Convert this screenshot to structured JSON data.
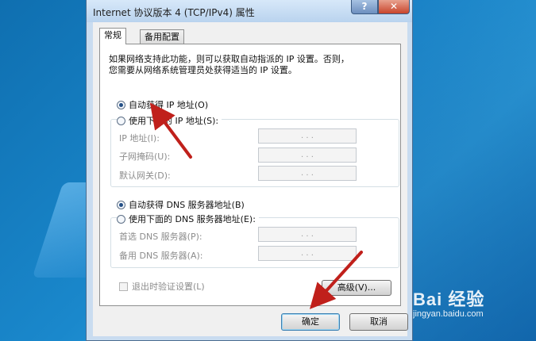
{
  "window": {
    "title": "Internet 协议版本 4 (TCP/IPv4) 属性",
    "help_glyph": "?",
    "close_glyph": "✕"
  },
  "tabs": [
    {
      "label": "常规",
      "active": true
    },
    {
      "label": "备用配置",
      "active": false
    }
  ],
  "description": {
    "line1": "如果网络支持此功能，则可以获取自动指派的 IP 设置。否则，",
    "line2": "您需要从网络系统管理员处获得适当的 IP 设置。"
  },
  "ip_section": {
    "auto_label": "自动获得 IP 地址(O)",
    "auto_checked": true,
    "manual_label": "使用下面的 IP 地址(S):",
    "manual_checked": false,
    "fields": [
      {
        "label": "IP 地址(I):",
        "value": ".   .   ."
      },
      {
        "label": "子网掩码(U):",
        "value": ".   .   ."
      },
      {
        "label": "默认网关(D):",
        "value": ".   .   ."
      }
    ]
  },
  "dns_section": {
    "auto_label": "自动获得 DNS 服务器地址(B)",
    "auto_checked": true,
    "manual_label": "使用下面的 DNS 服务器地址(E):",
    "manual_checked": false,
    "fields": [
      {
        "label": "首选 DNS 服务器(P):",
        "value": ".   .   ."
      },
      {
        "label": "备用 DNS 服务器(A):",
        "value": ".   .   ."
      }
    ]
  },
  "validate_checkbox": {
    "label": "退出时验证设置(L)",
    "checked": false
  },
  "advanced_button": "高级(V)...",
  "ok_button": "确定",
  "cancel_button": "取消",
  "watermark": {
    "logo": "Bai 经验",
    "url": "jingyan.baidu.com"
  },
  "colors": {
    "annotation_arrow": "#c0201b",
    "accent": "#234f86"
  }
}
